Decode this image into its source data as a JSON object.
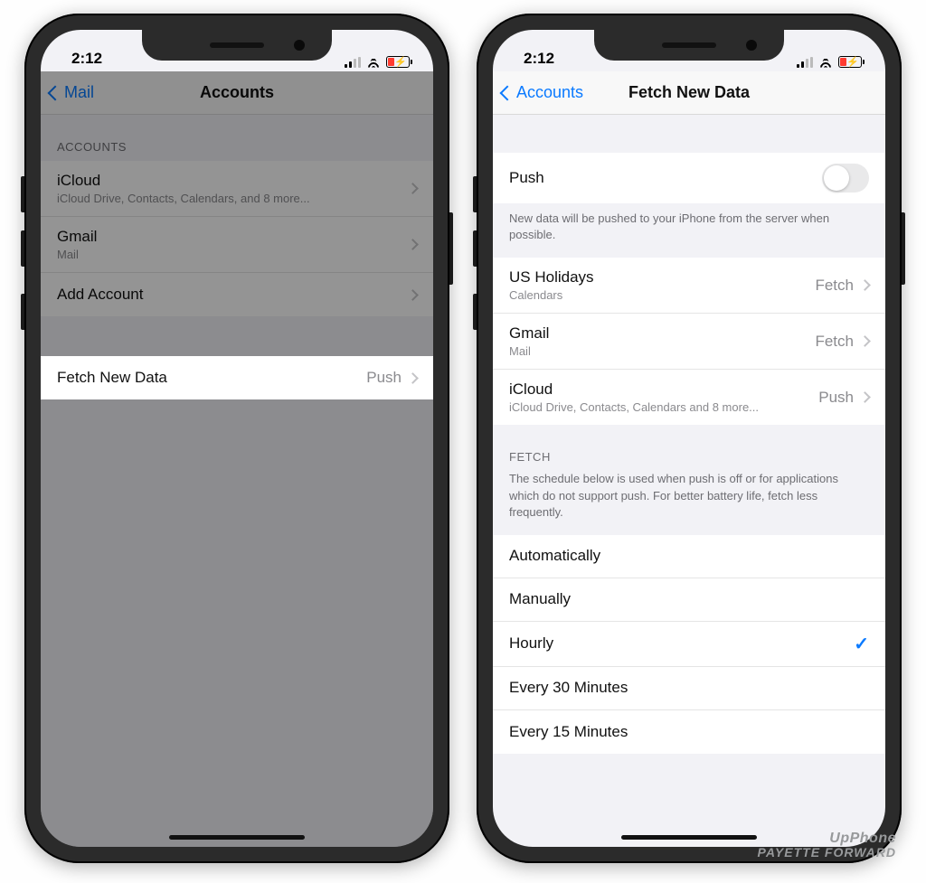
{
  "status": {
    "time": "2:12"
  },
  "left": {
    "nav": {
      "back": "Mail",
      "title": "Accounts"
    },
    "sections": {
      "accounts_header": "ACCOUNTS",
      "items": [
        {
          "label": "iCloud",
          "sub": "iCloud Drive, Contacts, Calendars, and 8 more..."
        },
        {
          "label": "Gmail",
          "sub": "Mail"
        },
        {
          "label": "Add Account",
          "sub": ""
        }
      ],
      "fetch": {
        "label": "Fetch New Data",
        "detail": "Push"
      }
    }
  },
  "right": {
    "nav": {
      "back": "Accounts",
      "title": "Fetch New Data"
    },
    "push": {
      "label": "Push",
      "on": false,
      "footer": "New data will be pushed to your iPhone from the server when possible."
    },
    "accounts": [
      {
        "label": "US Holidays",
        "sub": "Calendars",
        "detail": "Fetch"
      },
      {
        "label": "Gmail",
        "sub": "Mail",
        "detail": "Fetch"
      },
      {
        "label": "iCloud",
        "sub": "iCloud Drive, Contacts, Calendars and 8 more...",
        "detail": "Push"
      }
    ],
    "fetch": {
      "header": "FETCH",
      "footer": "The schedule below is used when push is off or for applications which do not support push. For better battery life, fetch less frequently.",
      "options": [
        {
          "label": "Automatically",
          "selected": false
        },
        {
          "label": "Manually",
          "selected": false
        },
        {
          "label": "Hourly",
          "selected": true
        },
        {
          "label": "Every 30 Minutes",
          "selected": false
        },
        {
          "label": "Every 15 Minutes",
          "selected": false
        }
      ]
    }
  },
  "watermark": {
    "line1": "UpPhone",
    "line2": "PAYETTE FORWARD"
  }
}
